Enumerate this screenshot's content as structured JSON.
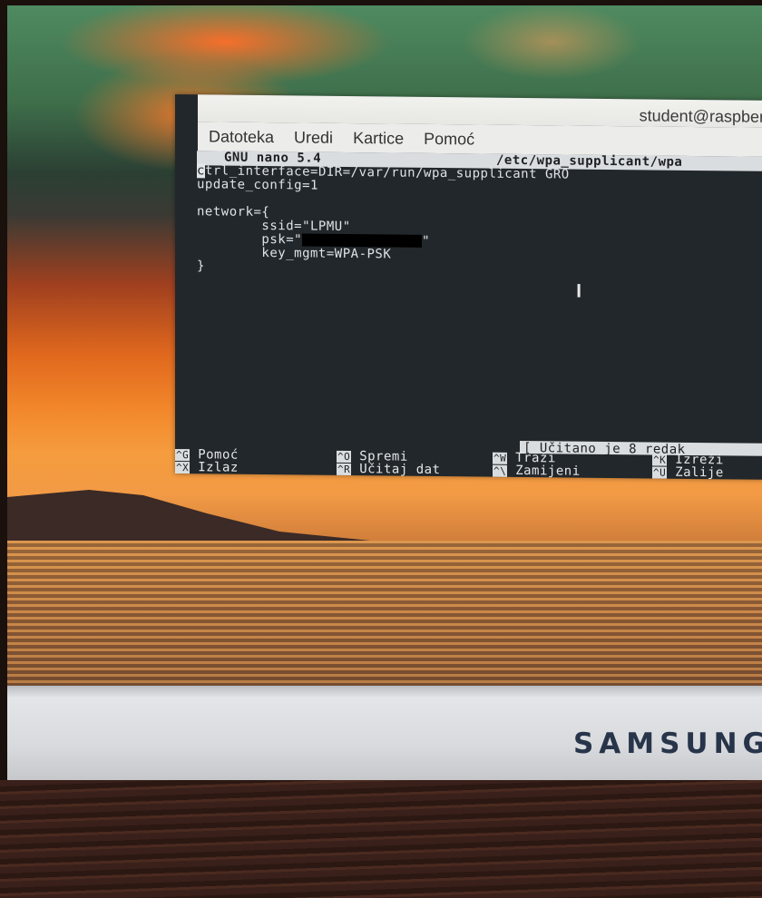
{
  "window": {
    "title": "student@raspber"
  },
  "menu": [
    "Datoteka",
    "Uredi",
    "Kartice",
    "Pomoć"
  ],
  "nano": {
    "version": "GNU nano 5.4",
    "filename": "/etc/wpa_supplicant/wpa",
    "lines": {
      "line1_cursor": "c",
      "line1_rest": "trl_interface=DIR=/var/run/wpa_supplicant GRO",
      "line2": "update_config=1",
      "line3": "",
      "line4": "network={",
      "line5": "        ssid=\"LPMU\"",
      "line6_prefix": "        psk=\"",
      "line6_suffix": "\"",
      "line7": "        key_mgmt=WPA-PSK",
      "line8": "}"
    },
    "status": "[ Učitano je 8 redak",
    "shortcuts": [
      {
        "key": "^G",
        "label": "Pomoć"
      },
      {
        "key": "^X",
        "label": "Izlaz"
      },
      {
        "key": "^O",
        "label": "Spremi"
      },
      {
        "key": "^R",
        "label": "Učitaj dat"
      },
      {
        "key": "^W",
        "label": "Traži"
      },
      {
        "key": "^\\",
        "label": "Zamijeni"
      },
      {
        "key": "^K",
        "label": "Izreži"
      },
      {
        "key": "^U",
        "label": "Zalije"
      }
    ]
  },
  "monitor": {
    "brand": "SAMSUNG"
  }
}
